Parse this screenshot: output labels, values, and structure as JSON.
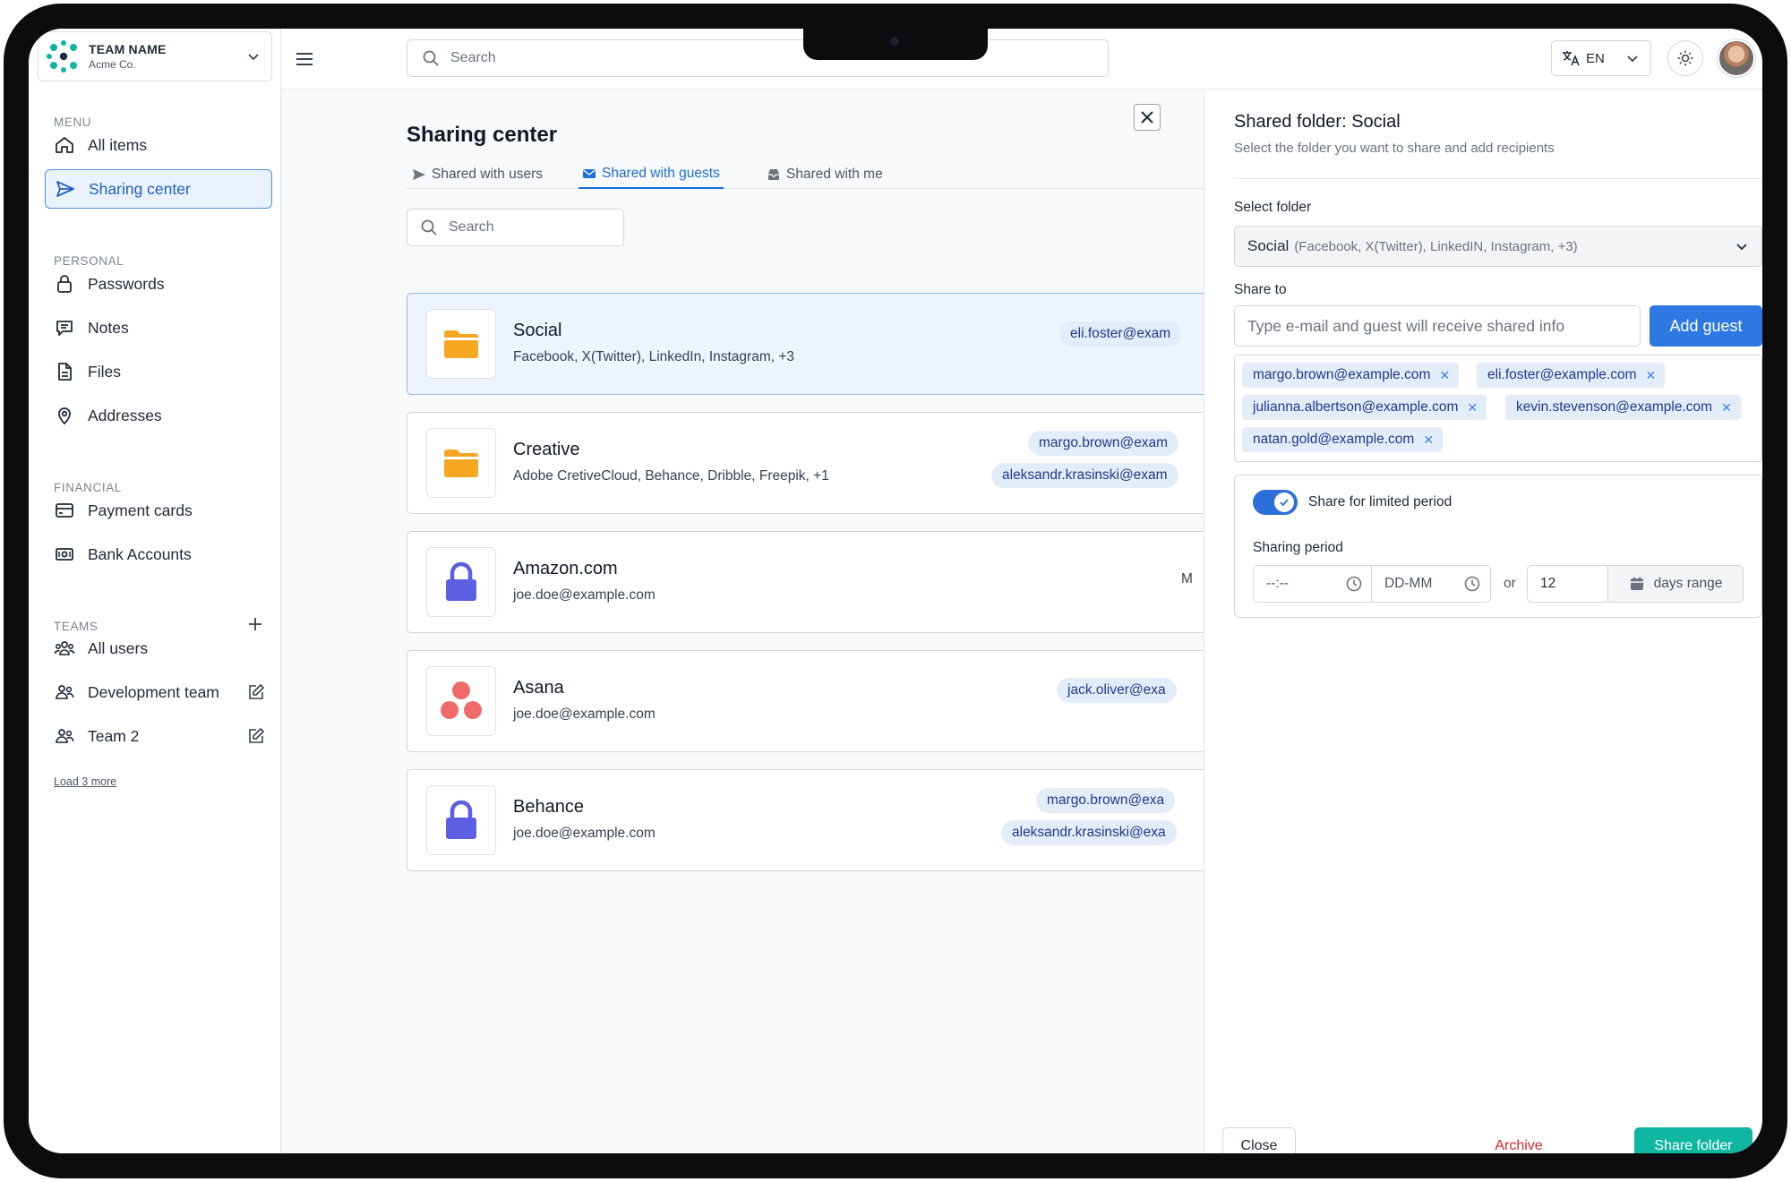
{
  "team": {
    "name": "TEAM NAME",
    "org": "Acme Co."
  },
  "sidebar": {
    "menu_heading": "MENU",
    "menu": [
      {
        "label": "All items",
        "icon": "home-icon"
      },
      {
        "label": "Sharing center",
        "icon": "send-icon",
        "active": true
      }
    ],
    "personal_heading": "PERSONAL",
    "personal": [
      {
        "label": "Passwords",
        "icon": "lock-icon"
      },
      {
        "label": "Notes",
        "icon": "note-icon"
      },
      {
        "label": "Files",
        "icon": "file-icon"
      },
      {
        "label": "Addresses",
        "icon": "location-pin-icon"
      }
    ],
    "financial_heading": "FINANCIAL",
    "financial": [
      {
        "label": "Payment cards",
        "icon": "credit-card-icon"
      },
      {
        "label": "Bank Accounts",
        "icon": "bank-note-icon"
      }
    ],
    "teams_heading": "TEAMS",
    "teams": [
      {
        "label": "All users",
        "icon": "users-group-icon"
      },
      {
        "label": "Development team",
        "icon": "users-icon",
        "editable": true
      },
      {
        "label": "Team 2",
        "icon": "users-icon",
        "editable": true
      }
    ],
    "load_more": "Load 3 more"
  },
  "topbar": {
    "search_placeholder": "Search",
    "language": "EN"
  },
  "main": {
    "title": "Sharing center",
    "tabs": [
      {
        "label": "Shared with users",
        "icon": "send-icon"
      },
      {
        "label": "Shared with guests",
        "icon": "envelope-icon",
        "active": true
      },
      {
        "label": "Shared with me",
        "icon": "inbox-icon"
      }
    ],
    "search_placeholder": "Search",
    "items": [
      {
        "title": "Social",
        "subtitle": "Facebook, X(Twitter), LinkedIn, Instagram, +3",
        "icon": "folder-icon",
        "chips": [
          "eli.foster@exam"
        ],
        "selected": true
      },
      {
        "title": "Creative",
        "subtitle": "Adobe CretiveCloud, Behance, Dribble, Freepik, +1",
        "icon": "folder-icon",
        "chips": [
          "margo.brown@exam",
          "aleksandr.krasinski@exam"
        ]
      },
      {
        "title": "Amazon.com",
        "subtitle": "joe.doe@example.com",
        "icon": "padlock-icon",
        "chips": [],
        "trailing_text": "M"
      },
      {
        "title": "Asana",
        "subtitle": "joe.doe@example.com",
        "icon": "asana-logo-icon",
        "chips": [
          "jack.oliver@exa"
        ]
      },
      {
        "title": "Behance",
        "subtitle": "joe.doe@example.com",
        "icon": "padlock-icon",
        "chips": [
          "margo.brown@exa",
          "aleksandr.krasinski@exa"
        ]
      }
    ]
  },
  "panel": {
    "title": "Shared folder: Social",
    "subtitle": "Select the folder you want to share and add recipients",
    "select_label": "Select folder",
    "select_value": "Social",
    "select_detail": "(Facebook, X(Twitter), LinkedIN, Instagram, +3)",
    "share_to_label": "Share to",
    "email_placeholder": "Type e-mail and guest will receive shared info",
    "add_guest": "Add guest",
    "recipients": [
      "margo.brown@example.com",
      "eli.foster@example.com",
      "julianna.albertson@example.com",
      "kevin.stevenson@example.com",
      "natan.gold@example.com"
    ],
    "limited_label": "Share for limited period",
    "limited_on": true,
    "sharing_period_label": "Sharing period",
    "time_placeholder": "--:--",
    "date_placeholder": "DD-MM",
    "or": "or",
    "days_value": "12",
    "days_label": "days range",
    "close": "Close",
    "archive": "Archive",
    "share": "Share folder"
  },
  "colors": {
    "accent": "#2d78e1",
    "teal": "#10b7a0",
    "danger": "#dc2626",
    "folder": "#f5a623",
    "lock": "#5b5fe0",
    "asana": "#f06a6a"
  }
}
